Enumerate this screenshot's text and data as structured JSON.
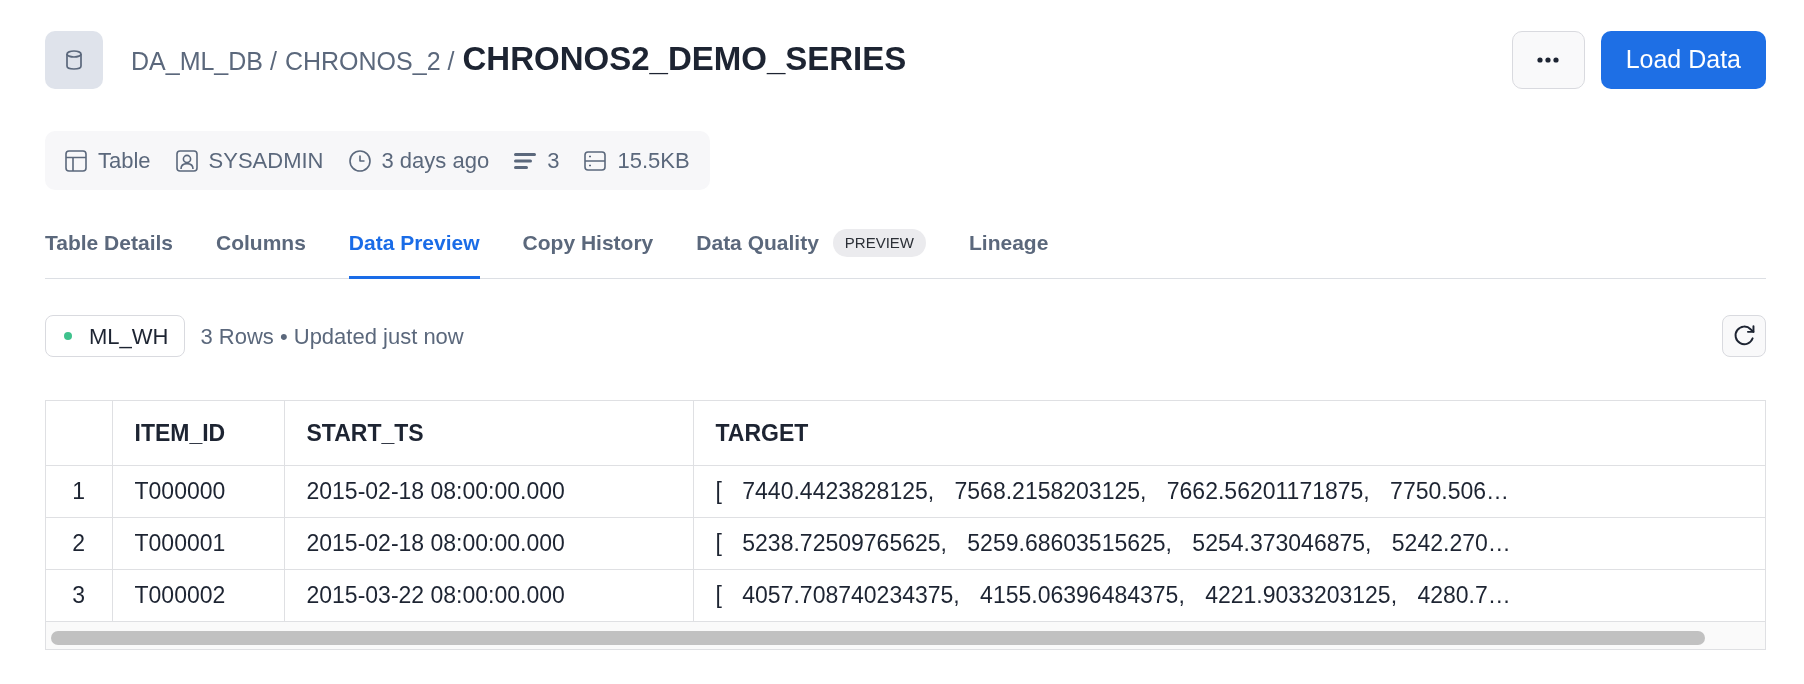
{
  "header": {
    "breadcrumb": [
      {
        "label": "DA_ML_DB",
        "separator": "/"
      },
      {
        "label": "CHRONOS_2",
        "separator": "/"
      }
    ],
    "title": "CHRONOS2_DEMO_SERIES",
    "load_button": "Load Data"
  },
  "meta": [
    {
      "kind": "type",
      "text": "Table"
    },
    {
      "kind": "owner",
      "text": "SYSADMIN"
    },
    {
      "kind": "modified",
      "text": "3 days ago"
    },
    {
      "kind": "rows",
      "text": "3"
    },
    {
      "kind": "size",
      "text": "15.5KB"
    }
  ],
  "tabs": [
    {
      "label": "Table Details",
      "selected": false
    },
    {
      "label": "Columns",
      "selected": false
    },
    {
      "label": "Data Preview",
      "selected": true
    },
    {
      "label": "Copy History",
      "selected": false
    },
    {
      "label": "Data Quality",
      "badge": "PREVIEW",
      "selected": false
    },
    {
      "label": "Lineage",
      "selected": false
    }
  ],
  "preview": {
    "warehouse": {
      "name": "ML_WH",
      "active": true
    },
    "summary": "3 Rows • Updated just now",
    "table": {
      "columns": [
        "ITEM_ID",
        "START_TS",
        "TARGET"
      ],
      "rows": [
        {
          "number": "1",
          "cells": [
            "T000000",
            "2015-02-18 08:00:00.000",
            "[ 7440.4423828125, 7568.2158203125, 7662.56201171875, 7750.506…"
          ]
        },
        {
          "number": "2",
          "cells": [
            "T000001",
            "2015-02-18 08:00:00.000",
            "[ 5238.72509765625, 5259.68603515625, 5254.373046875, 5242.270…"
          ]
        },
        {
          "number": "3",
          "cells": [
            "T000002",
            "2015-03-22 08:00:00.000",
            "[ 4057.708740234375, 4155.06396484375, 4221.9033203125, 4280.7…"
          ]
        }
      ]
    }
  }
}
